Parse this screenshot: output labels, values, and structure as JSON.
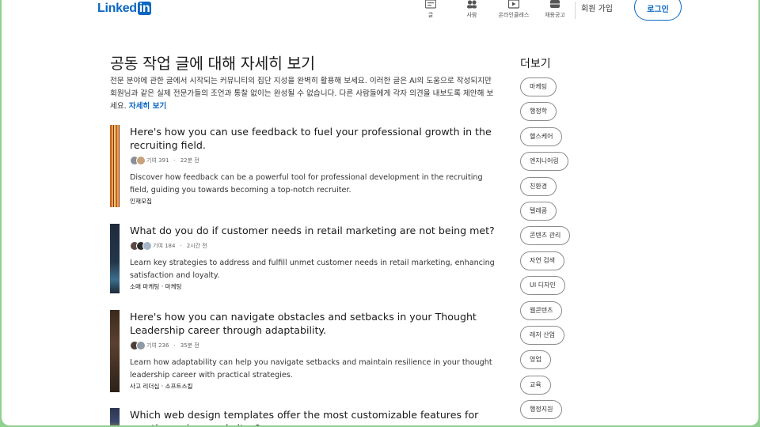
{
  "header": {
    "logo_text": "Linked",
    "logo_in": "in",
    "nav": [
      {
        "label": "글",
        "icon": "article-icon"
      },
      {
        "label": "사람",
        "icon": "people-icon"
      },
      {
        "label": "온라인클래스",
        "icon": "video-icon"
      },
      {
        "label": "채용공고",
        "icon": "briefcase-icon"
      }
    ],
    "join_label": "회원 가입",
    "signin_label": "로그인"
  },
  "main": {
    "title": "공동 작업 글에 대해 자세히 보기",
    "intro": "전문 분야에 관한 글에서 시작되는 커뮤니티의 집단 지성을 완벽히 활용해 보세요. 이러한 글은 AI의 도움으로 작성되지만 회원님과 같은 실제 전문가들의 조언과 통찰 없이는 완성될 수 없습니다. 다른 사람들에게 각자 의견을 내보도록 제안해 보세요.",
    "intro_link": "자세히 보기",
    "articles": [
      {
        "title": "Here's how you can use feedback to fuel your professional growth in the recruiting field.",
        "contributions": "기여 391",
        "time": "22분 전",
        "description": "Discover how feedback can be a powerful tool for professional development in the recruiting field, guiding you towards becoming a top-notch recruiter.",
        "tags": "인재모집"
      },
      {
        "title": "What do you do if customer needs in retail marketing are not being met?",
        "contributions": "기여 184",
        "time": "2시간 전",
        "description": "Learn key strategies to address and fulfill unmet customer needs in retail marketing, enhancing satisfaction and loyalty.",
        "tags": "소매 마케팅 · 마케팅"
      },
      {
        "title": "Here's how you can navigate obstacles and setbacks in your Thought Leadership career through adaptability.",
        "contributions": "기여 236",
        "time": "35분 전",
        "description": "Learn how adaptability can help you navigate setbacks and maintain resilience in your thought leadership career with practical strategies.",
        "tags": "사고 리더십 · 소프트스킬"
      },
      {
        "title": "Which web design templates offer the most customizable features for creating unique websites?"
      }
    ]
  },
  "sidebar": {
    "title": "더보기",
    "chips": [
      "마케팅",
      "행정학",
      "헬스케어",
      "엔지니어링",
      "친환경",
      "텔레콤",
      "콘텐츠 관리",
      "자연 검색",
      "UI 디자인",
      "웹콘텐츠",
      "레저 산업",
      "영업",
      "교육",
      "행정지원"
    ]
  },
  "colors": {
    "brand": "#0a66c2",
    "frame_border": "#8fd18f"
  }
}
